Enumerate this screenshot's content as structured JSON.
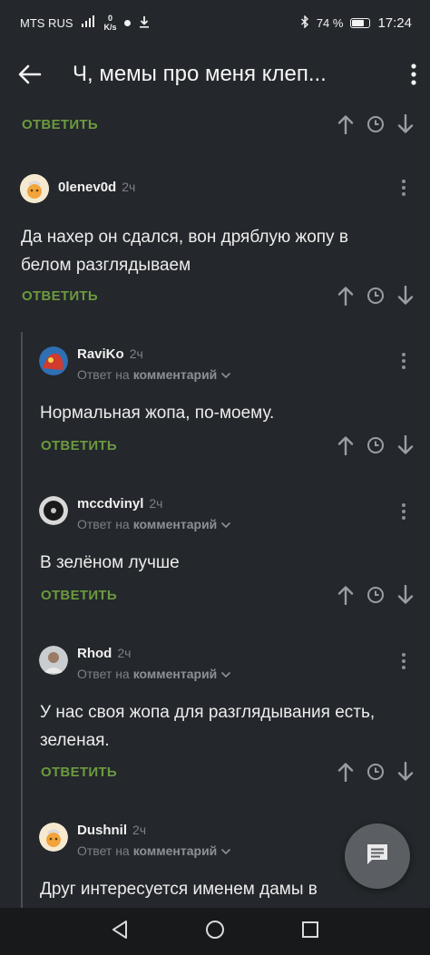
{
  "status_bar": {
    "carrier": "MTS RUS",
    "net_speed_value": "0",
    "net_speed_unit": "K/s",
    "battery": "74 %",
    "battery_level": 0.74,
    "time": "17:24"
  },
  "app_bar": {
    "title": "Ч, мемы про меня клеп..."
  },
  "reply_label": "ОТВЕТИТЬ",
  "reply_to_prefix": "Ответ на",
  "reply_to_target": "комментарий",
  "comments": [
    {
      "user": "0lenev0d",
      "time": "2ч",
      "text": "Да нахер он сдался, вон дряблую жопу в белом разглядываем"
    },
    {
      "user": "RaviKo",
      "time": "2ч",
      "text": "Нормальная жопа, по-моему."
    },
    {
      "user": "mccdvinyl",
      "time": "2ч",
      "text": "В зелёном лучше"
    },
    {
      "user": "Rhod",
      "time": "2ч",
      "text": "У нас своя жопа для разглядывания есть, зеленая."
    },
    {
      "user": "Dushnil",
      "time": "2ч",
      "text": "Друг интересуется именем дамы в"
    }
  ],
  "colors": {
    "background": "#24272b",
    "accent_reply": "#6b9a3f",
    "muted": "#7d8186"
  },
  "icons": [
    "back-arrow-icon",
    "more-vert-icon",
    "upvote-icon",
    "clock-icon",
    "downvote-icon",
    "comment-fab-icon"
  ]
}
